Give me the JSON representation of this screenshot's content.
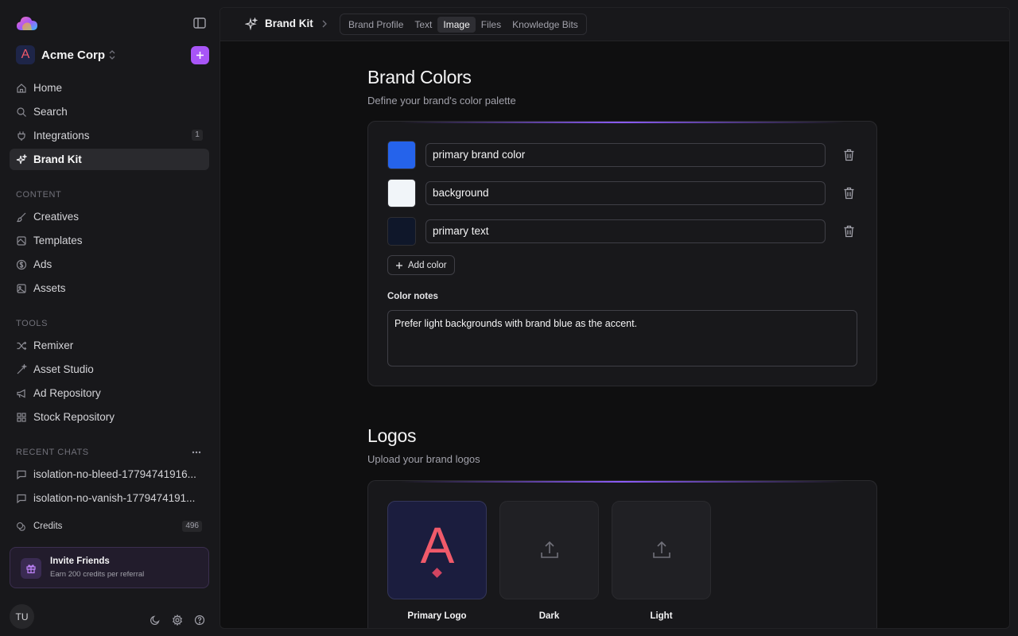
{
  "sidebar": {
    "workspace": {
      "name": "Acme Corp",
      "avatar_letter": "A"
    },
    "nav": [
      {
        "label": "Home",
        "icon": "home-icon"
      },
      {
        "label": "Search",
        "icon": "search-icon"
      },
      {
        "label": "Integrations",
        "icon": "plug-icon",
        "badge": "1"
      },
      {
        "label": "Brand Kit",
        "icon": "sparkle-icon",
        "active": true
      }
    ],
    "content_label": "CONTENT",
    "content_items": [
      "Creatives",
      "Templates",
      "Ads",
      "Assets"
    ],
    "tools_label": "TOOLS",
    "tools_items": [
      "Remixer",
      "Asset Studio",
      "Ad Repository",
      "Stock Repository"
    ],
    "recent_label": "RECENT CHATS",
    "recent_chats": [
      "isolation-no-bleed-17794741916...",
      "isolation-no-vanish-1779474191..."
    ],
    "credits_label": "Credits",
    "credits_value": "496",
    "invite": {
      "title": "Invite Friends",
      "subtitle": "Earn 200 credits per referral"
    },
    "user_initials": "TU"
  },
  "topbar": {
    "title": "Brand Kit",
    "tabs": [
      "Brand Profile",
      "Text",
      "Image",
      "Files",
      "Knowledge Bits"
    ],
    "active_tab": "Image"
  },
  "brand_colors": {
    "title": "Brand Colors",
    "subtitle": "Define your brand's color palette",
    "colors": [
      {
        "name": "primary brand color",
        "hex": "#2563eb"
      },
      {
        "name": "background",
        "hex": "#f1f5f9"
      },
      {
        "name": "primary text",
        "hex": "#0f172a"
      }
    ],
    "add_label": "Add color",
    "notes_label": "Color notes",
    "notes_value": "Prefer light backgrounds with brand blue as the accent."
  },
  "logos": {
    "title": "Logos",
    "subtitle": "Upload your brand logos",
    "tiles": [
      {
        "label": "Primary Logo",
        "letter": "A"
      },
      {
        "label": "Dark"
      },
      {
        "label": "Light"
      }
    ]
  },
  "accent_color": "#a855f7"
}
